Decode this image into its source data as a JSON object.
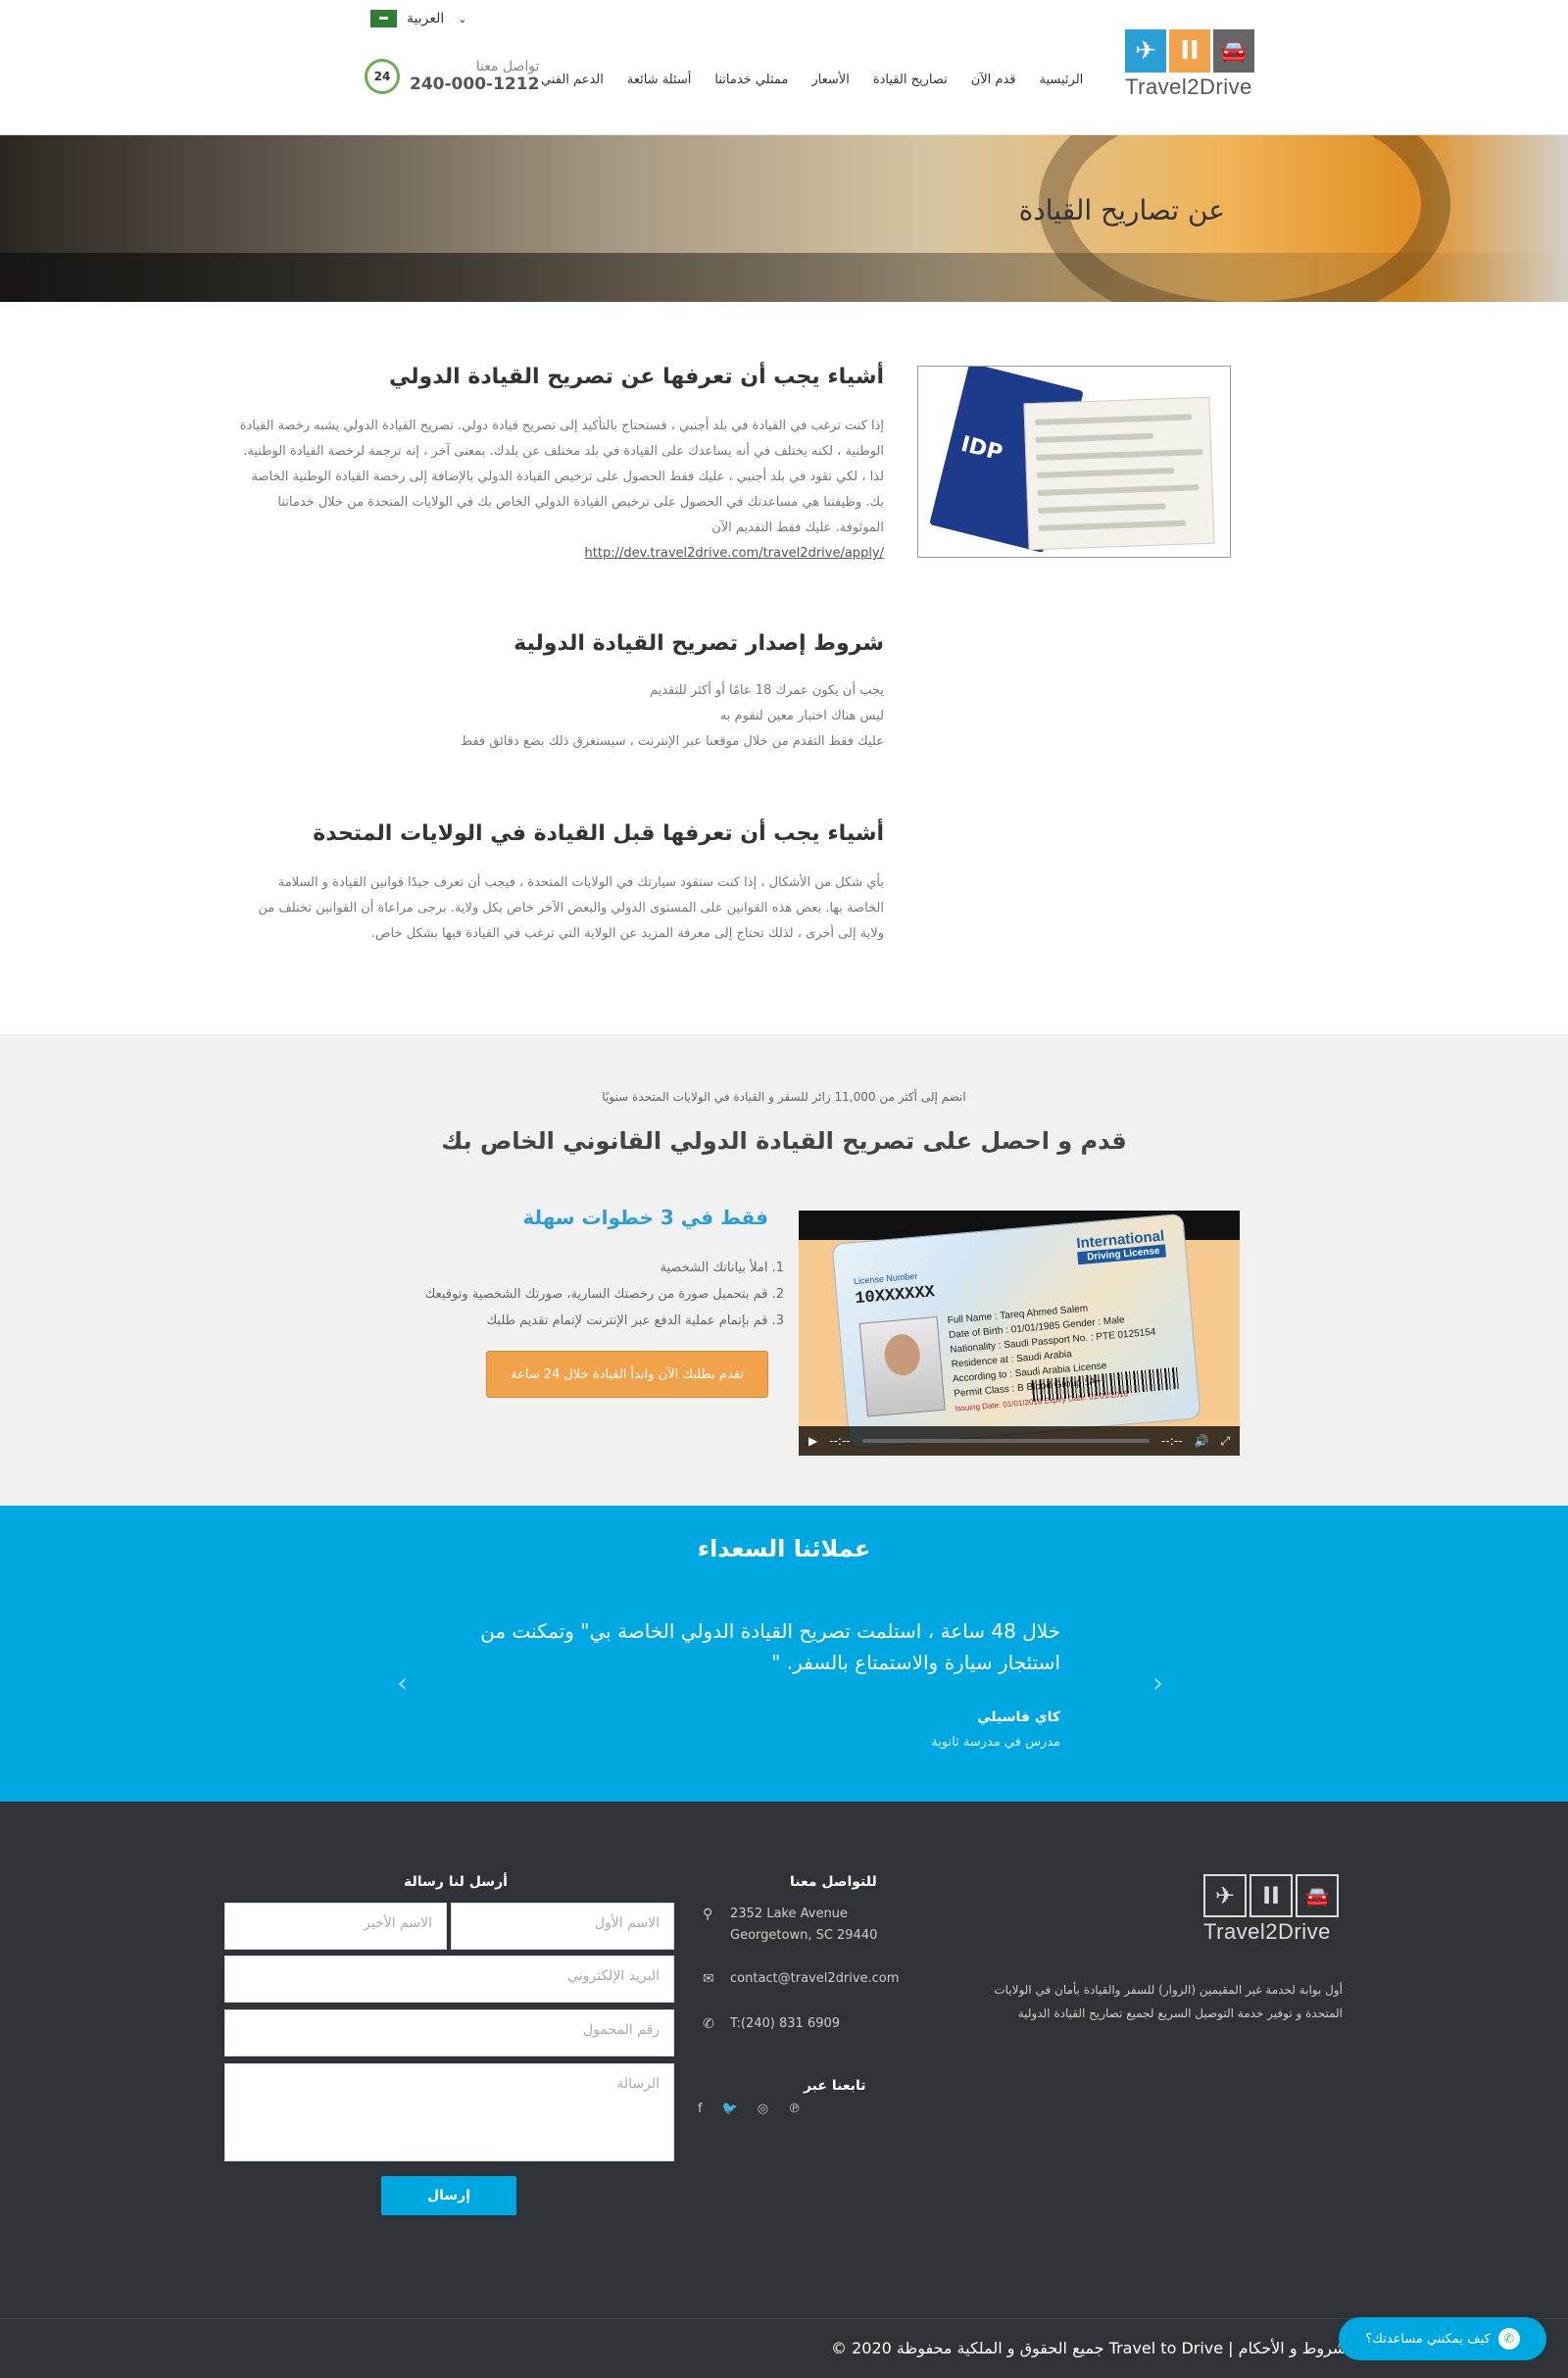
{
  "header": {
    "language": "العربية",
    "logo_text": "Travel2Drive",
    "nav": [
      "الرئيسية",
      "قدم الآن",
      "تصاريح القيادة",
      "الأسعار",
      "ممثلي خدماتنا",
      "أسئلة شائعة",
      "الدعم الفني"
    ],
    "contact_label": "تواصل معنا",
    "contact_number": "240-000-1212",
    "contact_badge": "24"
  },
  "hero": {
    "title": "عن تصاريح القيادة"
  },
  "idp_image": {
    "label": "IDP"
  },
  "section1": {
    "heading": "أشياء يجب أن تعرفها عن تصريح القيادة الدولي",
    "body": "إذا كنت ترغب في القيادة في بلد أجنبي ، فستحتاج بالتأكيد إلى تصريح قيادة دولي. تصريح القيادة الدولي يشبه رخصة القيادة الوطنية ، لكنه يختلف في أنه يساعدك على القيادة في بلد مختلف عن بلدك. بمعنى آخر ، إنه ترجمة لرخصة القيادة الوطنية. لذا ، لكي تقود في بلد أجنبي ، عليك فقط الحصول على ترخيص القيادة الدولي بالإضافة إلى رخصة القيادة الوطنية الخاصة بك. وظيفتنا هي مساعدتك في الحصول على ترخيص القيادة الدولي الخاص بك في الولايات المتحدة من خلال خدماتنا الموثوقة. عليك فقط التقديم الآن",
    "link": "http://dev.travel2drive.com/travel2drive/apply/"
  },
  "section2": {
    "heading": "شروط إصدار تصريح القيادة الدولية",
    "items": [
      "يجب أن يكون عمرك 18 عامًا أو أكثر للتقديم",
      "ليس هناك اختبار معين لتقوم به",
      "عليك فقط التقدم من خلال موقعنا عبر الإنترنت ، سيستغرق ذلك بضع دقائق فقط"
    ]
  },
  "section3": {
    "heading": "أشياء يجب أن تعرفها قبل القيادة في الولايات المتحدة",
    "body": "بأي شكل من الأشكال ، إذا كنت ستقود سيارتك في الولايات المتحدة ، فيجب أن تعرف جيدًا قوانين القيادة و السلامة الخاصة بها. بعض هذه القوانين على المستوى الدولي والبعض الآخر خاص بكل ولاية. برجى مراعاة أن القوانين تختلف من ولاية إلى أخرى ، لذلك تحتاج إلى معرفة المزيد عن الولاية التي ترغب في القيادة فيها بشكل خاص."
  },
  "cta": {
    "subtitle": "انضم إلى أكثر من 11,000 زائر للسفر و القيادة في الولايات المتحدة سنويًا",
    "heading": "قدم و احصل على تصريح القيادة الدولي القانوني الخاص بك",
    "steps_heading": "فقط في 3 خطوات سهلة",
    "steps": [
      "1. املأ بياناتك الشخصية",
      "2. قم بتحميل صورة من رخصتك السارية، صورتك الشخصية وتوقيعك",
      "3. قم بإتمام عملية الدفع عبر الإنترنت لإتمام تقديم طلبك"
    ],
    "button": "تقدم بطلبك الآن وابدأ القيادة خلال 24 ساعة"
  },
  "video": {
    "title_line1": "International",
    "title_line2": "Driving License",
    "license_label": "License Number",
    "license_number": "10XXXXXX",
    "fields": [
      "Full Name : Tareq Ahmed Salem",
      "Date of Birth : 01/01/1985   Gender : Male",
      "Nationality : Saudi   Passport No. : PTE 0125154",
      "Residence at : Saudi Arabia",
      "According to : Saudi Arabia License",
      "Permit Class : B   Blood Group : A+",
      "Issuing Date: 01/01/2018   Expiry Date: 01/01/2018"
    ],
    "time_elapsed": "--:--",
    "time_total": "--:--"
  },
  "testimonials": {
    "heading": "عملائنا السعداء",
    "quote": "خلال 48 ساعة ، استلمت تصريح القيادة الدولي الخاصة بي\" وتمكنت من استئجار سيارة والاستمتاع بالسفر. \"",
    "name": "كاي فاسيلي",
    "role": "مدرس في مدرسة ثانوية"
  },
  "footer": {
    "logo_text": "Travel2Drive",
    "description": "أول بوابة لخدمة غير المقيمين (الزوار) للسفر والقيادة بأمان في الولايات المتحدة و توفير خدمة التوصيل السريع لجميع تصاريح القيادة الدولية",
    "contact_heading": "للتواصل معنا",
    "address_line1": "2352 Lake Avenue",
    "address_line2": "Georgetown, SC 29440",
    "email": "contact@travel2drive.com",
    "phone": "T:(240) 831 6909",
    "follow_heading": "تابعنا عبر",
    "form_heading": "أرسل لنا رسالة",
    "first_name": "الاسم الأول",
    "last_name": "الاسم الأخير",
    "email_ph": "البريد الإلكتروني",
    "mobile_ph": "رقم المحمول",
    "message_ph": "الرسالة",
    "send": "إرسال",
    "copyright": "الشروط و الأحكام | Travel to Drive جميع الحقوق و الملكية محفوظة 2020 ©",
    "whatsapp": "كيف يمكنني مساعدتك؟"
  },
  "colors": {
    "accent_blue": "#00a8e1",
    "orange": "#f0a34a",
    "footer_bg": "#2f3338"
  },
  "icons": [
    "flag-sa-icon",
    "chevron-down-icon",
    "phone-24-icon",
    "plane-icon",
    "car-icon",
    "map-pin-icon",
    "envelope-icon",
    "phone-icon",
    "facebook-icon",
    "twitter-icon",
    "dribbble-icon",
    "pinterest-icon",
    "whatsapp-icon",
    "play-icon",
    "volume-icon",
    "fullscreen-icon"
  ]
}
